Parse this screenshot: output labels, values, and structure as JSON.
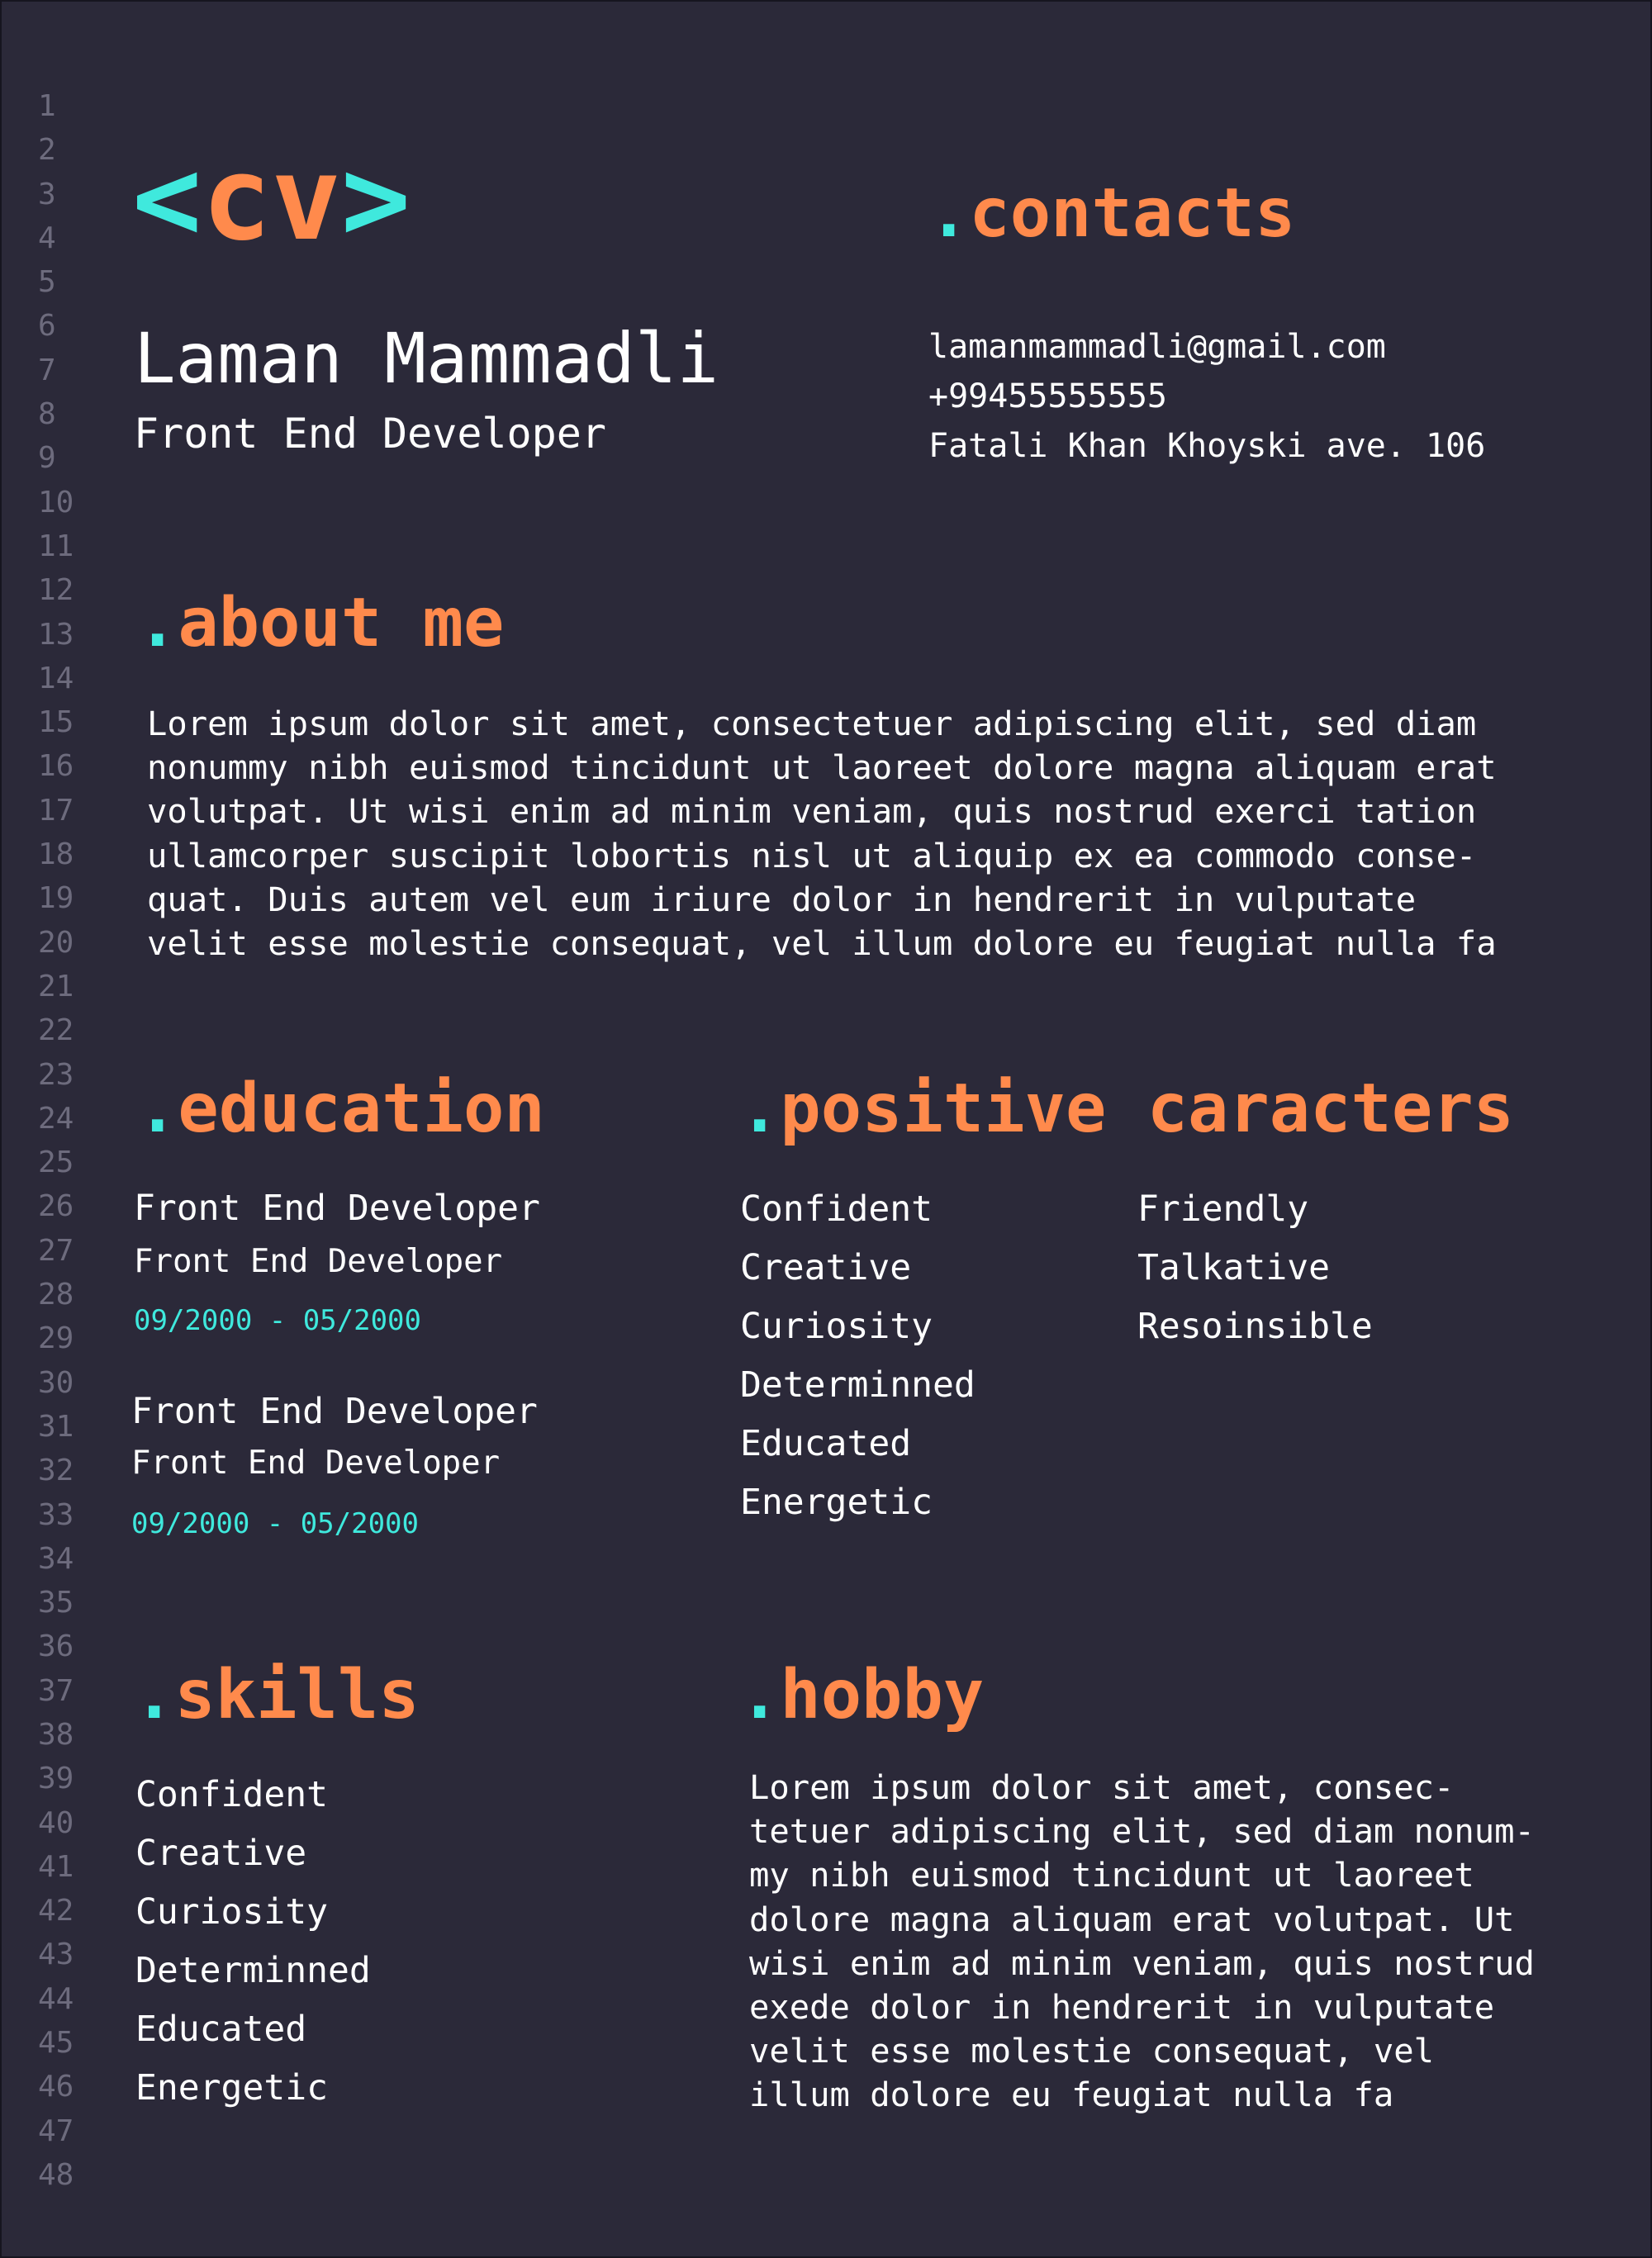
{
  "line_numbers": [
    "1",
    "2",
    "3",
    "4",
    "5",
    "6",
    "7",
    "8",
    "9",
    "10",
    "11",
    "12",
    "13",
    "14",
    "15",
    "16",
    "17",
    "18",
    "19",
    "20",
    "21",
    "22",
    "23",
    "24",
    "25",
    "26",
    "27",
    "28",
    "29",
    "30",
    "31",
    "32",
    "33",
    "34",
    "35",
    "36",
    "37",
    "38",
    "39",
    "40",
    "41",
    "42",
    "43",
    "44",
    "45",
    "46",
    "47",
    "48"
  ],
  "logo": {
    "open": "<",
    "text": "cv",
    "close": ">"
  },
  "person": {
    "name": "Laman Mammadli",
    "title": "Front End Developer"
  },
  "contacts": {
    "dot": ".",
    "heading": "contacts",
    "email": "lamanmammadli@gmail.com",
    "phone": "+99455555555",
    "address": "Fatali Khan Khoyski ave. 106"
  },
  "about": {
    "dot": ".",
    "heading": "about me",
    "lines": [
      "Lorem ipsum dolor sit amet, consectetuer adipiscing elit, sed diam",
      "nonummy nibh euismod tincidunt ut laoreet dolore magna aliquam erat",
      "volutpat. Ut wisi enim ad minim veniam, quis nostrud exerci tation",
      "ullamcorper suscipit lobortis nisl ut aliquip ex ea commodo conse-",
      "quat. Duis autem vel eum iriure dolor in hendrerit in vulputate",
      "velit esse molestie consequat, vel illum dolore eu feugiat nulla fa"
    ]
  },
  "education": {
    "dot": ".",
    "heading": "education",
    "entries": [
      {
        "title": "Front End Developer",
        "subtitle": "Front End Developer",
        "dates": "09/2000 - 05/2000"
      },
      {
        "title": "Front End Developer",
        "subtitle": "Front End Developer",
        "dates": "09/2000 - 05/2000"
      }
    ]
  },
  "positive": {
    "dot": ".",
    "heading": "positive caracters",
    "column1": [
      "Confident",
      "Creative",
      "Curiosity",
      "Determinned",
      "Educated",
      "Energetic"
    ],
    "column2": [
      "Friendly",
      "Talkative",
      "Resoinsible"
    ]
  },
  "skills": {
    "dot": ".",
    "heading": "skills",
    "items": [
      "Confident",
      "Creative",
      "Curiosity",
      "Determinned",
      "Educated",
      "Energetic"
    ]
  },
  "hobby": {
    "dot": ".",
    "heading": "hobby",
    "lines": [
      "Lorem ipsum dolor sit amet, consec-",
      "tetuer adipiscing elit, sed diam nonum-",
      "my nibh euismod tincidunt ut laoreet",
      "dolore magna aliquam erat volutpat. Ut",
      "wisi enim ad minim veniam, quis nostrud",
      "exede dolor in hendrerit in vulputate",
      "velit esse molestie consequat, vel",
      "illum dolore eu feugiat nulla fa"
    ]
  },
  "colors": {
    "background": "#2b2939",
    "accent_orange": "#ff8a4c",
    "accent_cyan": "#3fe9dd",
    "line_number_gray": "#6d6b7d",
    "text": "#ffffff"
  }
}
